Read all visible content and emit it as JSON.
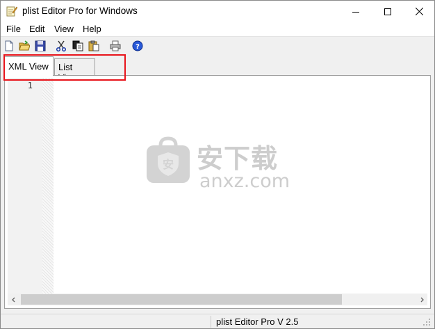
{
  "window": {
    "title": "plist Editor Pro for Windows",
    "app_icon": "notepad-pencil-icon",
    "controls": [
      "minimize-icon",
      "maximize-icon",
      "close-icon"
    ]
  },
  "menu": {
    "items": [
      "File",
      "Edit",
      "View",
      "Help"
    ]
  },
  "toolbar": {
    "icons": [
      "new-file-icon",
      "open-folder-icon",
      "save-icon",
      "cut-icon",
      "copy-icon",
      "paste-icon",
      "print-icon",
      "help-icon"
    ]
  },
  "tabs": {
    "xml_view": "XML View",
    "list_view": "List View",
    "active": "XML View"
  },
  "editor": {
    "line_numbers": [
      "1"
    ],
    "content": ""
  },
  "watermark": {
    "text_cn": "安下载",
    "text_en": "anxz.com"
  },
  "status": {
    "version_text": "plist Editor Pro V 2.5"
  },
  "colors": {
    "highlight": "#e8141b",
    "titlebar": "#ffffff",
    "chrome": "#f0f0f0"
  }
}
